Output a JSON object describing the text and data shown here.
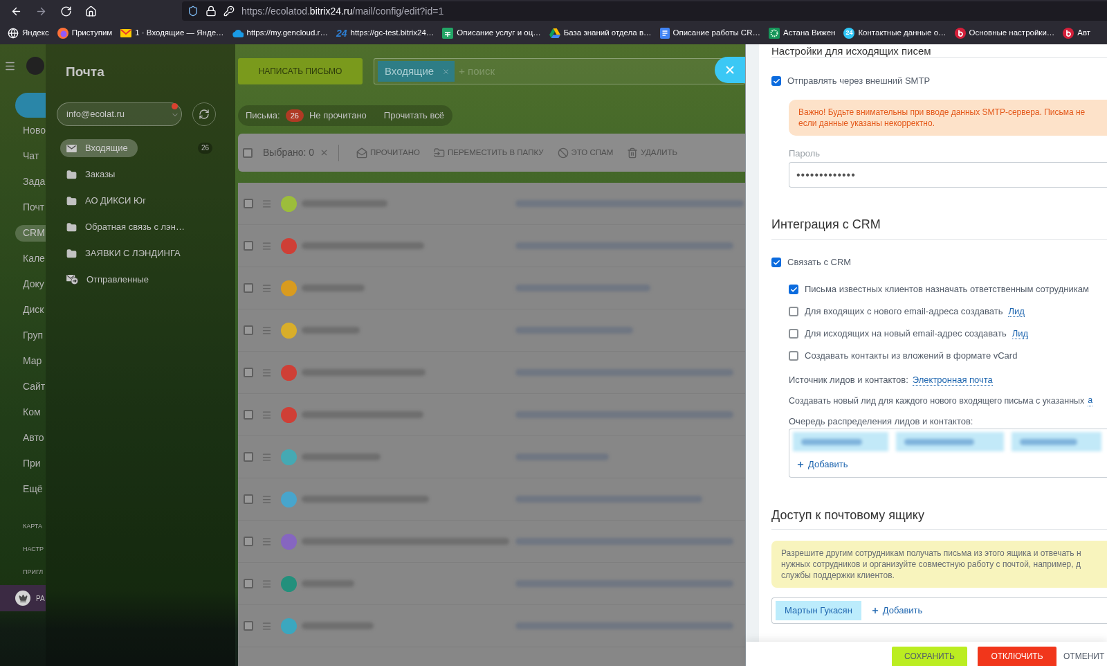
{
  "browser": {
    "nav_buttons": [
      {
        "kind": "back",
        "disabled": false
      },
      {
        "kind": "forward",
        "disabled": true
      },
      {
        "kind": "reload",
        "disabled": false
      },
      {
        "kind": "home",
        "disabled": false
      }
    ],
    "url": {
      "start": "https://ecolatod.",
      "domain": "bitrix24.ru",
      "path": "/mail/config/edit?id=1"
    },
    "bookmarks": [
      {
        "kind": "globe",
        "label": "Яндекс"
      },
      {
        "kind": "browser",
        "label": "Приступим"
      },
      {
        "kind": "mail",
        "label": "1 · Входящие — Янде…"
      },
      {
        "kind": "cloud",
        "label": "https://my.gencloud.r…"
      },
      {
        "kind": "number",
        "badge": "24",
        "label": "https://gc-test.bitrix24…"
      },
      {
        "kind": "sheet",
        "label": "Описание услуг и оц…"
      },
      {
        "kind": "drive",
        "label": "База знаний отдела в…"
      },
      {
        "kind": "doc",
        "label": "Описание работы CR…"
      },
      {
        "kind": "ring",
        "label": "Астана Вижен"
      },
      {
        "kind": "number_circle",
        "badge": "24",
        "label": "Контактные данные о…"
      },
      {
        "kind": "swirl",
        "label": "Основные настройки…"
      },
      {
        "kind": "swirl",
        "label": "Авт"
      }
    ]
  },
  "left_menu": {
    "items": [
      {
        "label": "Ново",
        "selected": false
      },
      {
        "label": "Чат",
        "selected": false
      },
      {
        "label": "Зада",
        "selected": false
      },
      {
        "label": "Почт",
        "selected": false
      },
      {
        "label": "CRM",
        "selected": true
      },
      {
        "label": "Кале",
        "selected": false
      },
      {
        "label": "Доку",
        "selected": false
      },
      {
        "label": "Диск",
        "selected": false
      },
      {
        "label": "Груп",
        "selected": false
      },
      {
        "label": "Мар",
        "selected": false
      },
      {
        "label": "Сайт",
        "selected": false
      },
      {
        "label": "Ком",
        "selected": false
      },
      {
        "label": "Авто",
        "selected": false
      },
      {
        "label": "При",
        "selected": false
      },
      {
        "label": "Ещё",
        "selected": false
      }
    ],
    "small_links": [
      "КАРТА",
      "НАСТР",
      "ПРИГЛ"
    ],
    "plan": {
      "label": "РА"
    }
  },
  "mail_sidebar": {
    "title": "Почта",
    "mailbox": "info@ecolat.ru",
    "notification": true,
    "folders": [
      {
        "kind": "inbox",
        "label": "Входящие",
        "selected": true,
        "count": "26"
      },
      {
        "kind": "folder",
        "label": "Заказы",
        "selected": false
      },
      {
        "kind": "folder",
        "label": "АО ДИКСИ Юг",
        "selected": false
      },
      {
        "kind": "folder",
        "label": "Обратная связь с лэн…",
        "selected": false
      },
      {
        "kind": "folder",
        "label": "ЗАЯВКИ С ЛЭНДИНГА",
        "selected": false
      },
      {
        "kind": "sent",
        "label": "Отправленные",
        "selected": false
      }
    ]
  },
  "mail": {
    "compose": "НАПИСАТЬ ПИСЬМО",
    "search": {
      "tag": "Входящие",
      "placeholder": "+ поиск"
    },
    "counters": {
      "label": "Письма:",
      "count": "26",
      "unread": "Не прочитано",
      "read_all": "Прочитать всё"
    },
    "toolbar": {
      "checked": false,
      "selected": "Выбрано: 0",
      "actions": [
        {
          "kind": "read",
          "label": "ПРОЧИТАНО"
        },
        {
          "kind": "move",
          "label": "ПЕРЕМЕСТИТЬ В ПАПКУ"
        },
        {
          "kind": "spam",
          "label": "ЭТО СПАМ"
        },
        {
          "kind": "delete",
          "label": "УДАЛИТЬ"
        }
      ]
    },
    "rows": [
      {
        "color": "#9cbd3b",
        "checked": false
      },
      {
        "color": "#cf3f36",
        "checked": false
      },
      {
        "color": "#d99b1f",
        "checked": false
      },
      {
        "color": "#d9ae2a",
        "checked": false
      },
      {
        "color": "#cf3f36",
        "checked": false
      },
      {
        "color": "#cf3f36",
        "checked": false
      },
      {
        "color": "#45a9b3",
        "checked": false
      },
      {
        "color": "#48a5cc",
        "checked": false
      },
      {
        "color": "#8666c0",
        "checked": false
      },
      {
        "color": "#23907c",
        "checked": false
      },
      {
        "color": "#3ba7bf",
        "checked": false
      }
    ]
  },
  "settings": {
    "outgoing_title": "Настройки для исходящих писем",
    "smtp": {
      "label": "Отправлять через внешний SMTP",
      "checked": true
    },
    "warning": [
      "Важно! Будьте внимательны при вводе данных SMTP-сервера. Письма не",
      "если данные указаны некорректно."
    ],
    "password": {
      "label": "Пароль",
      "value": "•••••••••••••"
    },
    "crm": {
      "title": "Интеграция с CRM",
      "bind": {
        "label": "Связать с CRM",
        "checked": true
      },
      "options": [
        {
          "label": "Письма известных клиентов назначать ответственным сотрудникам",
          "checked": true
        },
        {
          "label": "Для входящих с нового email-адреса создавать",
          "link": "Лид",
          "checked": false
        },
        {
          "label": "Для исходящих на новый email-адрес создавать",
          "link": "Лид",
          "checked": false
        },
        {
          "label": "Создавать контакты из вложений в формате vCard",
          "checked": false
        }
      ],
      "source": {
        "label": "Источник лидов и контактов:",
        "link": "Электронная почта"
      },
      "new_lead": {
        "label": "Создавать новый лид для каждого нового входящего письма с указанных",
        "link": "а"
      },
      "queue": {
        "label": "Очередь распределения лидов и контактов:",
        "add": "Добавить"
      }
    },
    "access": {
      "title": "Доступ к почтовому ящику",
      "info": [
        "Разрешите другим сотрудникам получать письма из этого ящика и отвечать н",
        "нужных сотрудников и организуйте совместную работу с почтой, например, д",
        "службы поддержки клиентов."
      ],
      "members": [
        {
          "name": "Мартын Гукасян"
        }
      ],
      "add": "Добавить"
    },
    "buttons": [
      {
        "kind": "save",
        "label": "СОХРАНИТЬ"
      },
      {
        "kind": "disable",
        "label": "ОТКЛЮЧИТЬ"
      },
      {
        "kind": "cancel",
        "label": "ОТМЕНИТ"
      }
    ]
  }
}
